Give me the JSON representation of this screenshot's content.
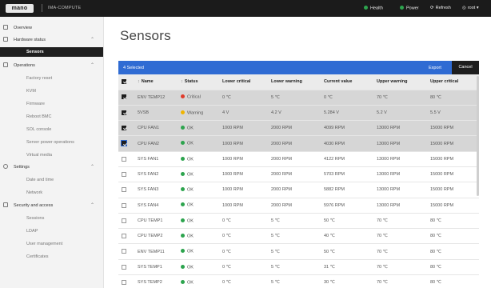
{
  "topbar": {
    "logo": "mano",
    "hostname": "IMA-COMPUTE",
    "health_label": "Health",
    "power_label": "Power",
    "refresh_label": "Refresh",
    "user_label": "root",
    "accent_green": "#2da44e"
  },
  "sidebar": {
    "overview": "Overview",
    "hardware_status": "Hardware status",
    "sensors": "Sensors",
    "operations": "Operations",
    "factory_reset": "Factory reset",
    "kvm": "KVM",
    "firmware": "Firmware",
    "reboot_bmc": "Reboot BMC",
    "sol_console": "SOL console",
    "server_power_operations": "Server power operations",
    "virtual_media": "Virtual media",
    "settings": "Settings",
    "date_and_time": "Date and time",
    "network": "Network",
    "security_and_access": "Security and access",
    "sessions": "Sessions",
    "ldap": "LDAP",
    "user_management": "User management",
    "certificates": "Certificates"
  },
  "page": {
    "title": "Sensors"
  },
  "selection_bar": {
    "count_text": "4 Selected",
    "export_label": "Export",
    "cancel_label": "Cancel",
    "bar_color": "#2f6bd3"
  },
  "table": {
    "columns": [
      "Name",
      "Status",
      "Lower critical",
      "Lower warning",
      "Current value",
      "Upper warning",
      "Upper critical"
    ],
    "rows": [
      {
        "name": "ENV TEMP12",
        "status": "Critical",
        "lc": "0 ℃",
        "lw": "5 ℃",
        "cur": "0 ℃",
        "uw": "70 ℃",
        "uc": "80 ℃"
      },
      {
        "name": "5VSB",
        "status": "Warning",
        "lc": "4 V",
        "lw": "4.2 V",
        "cur": "5.284 V",
        "uw": "5.2 V",
        "uc": "5.5 V"
      },
      {
        "name": "CPU FAN1",
        "status": "OK",
        "lc": "1000 RPM",
        "lw": "2000 RPM",
        "cur": "4099 RPM",
        "uw": "13000 RPM",
        "uc": "15000 RPM"
      },
      {
        "name": "CPU FAN2",
        "status": "OK",
        "lc": "1000 RPM",
        "lw": "2000 RPM",
        "cur": "4030 RPM",
        "uw": "13000 RPM",
        "uc": "15000 RPM"
      },
      {
        "name": "SYS FAN1",
        "status": "OK",
        "lc": "1000 RPM",
        "lw": "2000 RPM",
        "cur": "4122 RPM",
        "uw": "13000 RPM",
        "uc": "15000 RPM"
      },
      {
        "name": "SYS FAN2",
        "status": "OK",
        "lc": "1000 RPM",
        "lw": "2000 RPM",
        "cur": "5703 RPM",
        "uw": "13000 RPM",
        "uc": "15000 RPM"
      },
      {
        "name": "SYS FAN3",
        "status": "OK",
        "lc": "1000 RPM",
        "lw": "2000 RPM",
        "cur": "5882 RPM",
        "uw": "13000 RPM",
        "uc": "15000 RPM"
      },
      {
        "name": "SYS FAN4",
        "status": "OK",
        "lc": "1000 RPM",
        "lw": "2000 RPM",
        "cur": "5976 RPM",
        "uw": "13000 RPM",
        "uc": "15000 RPM"
      },
      {
        "name": "CPU TEMP1",
        "status": "OK",
        "lc": "0 ℃",
        "lw": "5 ℃",
        "cur": "50 ℃",
        "uw": "70 ℃",
        "uc": "80 ℃"
      },
      {
        "name": "CPU TEMP2",
        "status": "OK",
        "lc": "0 ℃",
        "lw": "5 ℃",
        "cur": "40 ℃",
        "uw": "70 ℃",
        "uc": "80 ℃"
      },
      {
        "name": "ENV TEMP11",
        "status": "OK",
        "lc": "0 ℃",
        "lw": "5 ℃",
        "cur": "50 ℃",
        "uw": "70 ℃",
        "uc": "80 ℃"
      },
      {
        "name": "SYS TEMP1",
        "status": "OK",
        "lc": "0 ℃",
        "lw": "5 ℃",
        "cur": "31 ℃",
        "uw": "70 ℃",
        "uc": "80 ℃"
      },
      {
        "name": "SYS TEMP2",
        "status": "OK",
        "lc": "0 ℃",
        "lw": "5 ℃",
        "cur": "30 ℃",
        "uw": "70 ℃",
        "uc": "80 ℃"
      }
    ],
    "status_colors": {
      "Critical": "#e03b2b",
      "Warning": "#f0b400",
      "OK": "#2da44e"
    },
    "selected_rows": [
      0,
      1,
      2,
      3
    ]
  }
}
